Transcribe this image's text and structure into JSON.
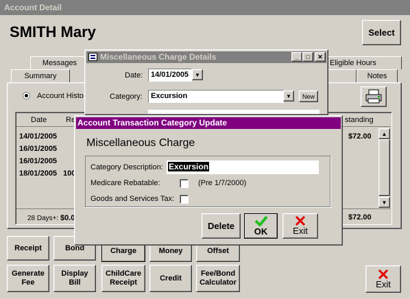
{
  "main_window": {
    "title": "Account Detail",
    "client_name": "SMITH Mary",
    "select_label": "Select"
  },
  "tabs": {
    "row1": [
      "Messages",
      "Eligible Hours"
    ],
    "row2": [
      "Summary",
      "Notes"
    ]
  },
  "account_history_label": "Account Histo",
  "table": {
    "col_date": "Date",
    "col_ref": "Re",
    "col_outstanding": "standing",
    "dates": [
      "14/01/2005",
      "16/01/2005",
      "16/01/2005",
      "18/01/2005"
    ],
    "ref_fragment": "100",
    "first_amount": "$72.00",
    "footer_days": "28 Days+:",
    "footer_amount": "$0.0",
    "total": "$72.00"
  },
  "bottom_buttons": {
    "receipt": "Receipt",
    "bond": "Bond",
    "charge": "Charge",
    "money": "Money",
    "offset": "Offset",
    "generate_fee": "Generate Fee",
    "display_bill": "Display Bill",
    "childcare_receipt": "ChildCare Receipt",
    "credit": "Credit",
    "fee_bond_calculator": "Fee/Bond Calculator",
    "exit": "Exit"
  },
  "misc_dialog": {
    "title": "Miscellaneous Charge Details",
    "date_label": "Date:",
    "date_value": "14/01/2005",
    "category_label": "Category:",
    "category_value": "Excursion",
    "new_label": "New"
  },
  "cat_dialog": {
    "title": "Account Transaction Category Update",
    "heading": "Miscellaneous Charge",
    "description_label": "Category Description:",
    "description_value": "Excursion",
    "medicare_label": "Medicare Rebatable:",
    "medicare_note": "(Pre 1/7/2000)",
    "gst_label": "Goods and Services Tax:",
    "delete_label": "Delete",
    "ok_label": "OK",
    "exit_label": "Exit"
  },
  "colors": {
    "dialog_title": "#800080",
    "inactive_title": "#808080",
    "face": "#d4d0c8",
    "ok_check": "#1fbf1f",
    "exit_x": "#e00000"
  },
  "icons": [
    "printer-icon",
    "dialog-app-icon",
    "ok-check-icon",
    "exit-x-icon",
    "radio-icon"
  ]
}
